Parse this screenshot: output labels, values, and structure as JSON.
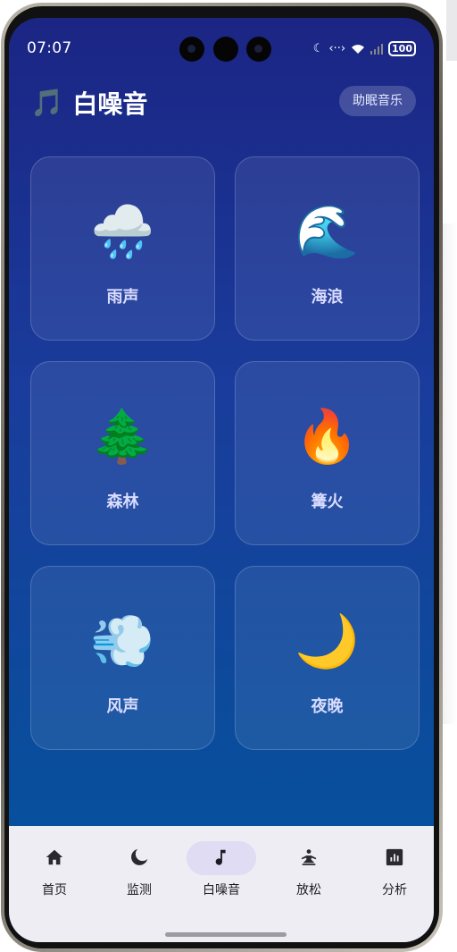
{
  "status_bar": {
    "time": "07:07",
    "battery": "100"
  },
  "header": {
    "icon": "🎵",
    "title": "白噪音",
    "action_label": "助眠音乐"
  },
  "sounds": [
    {
      "emoji": "🌧️",
      "label": "雨声",
      "icon_name": "rain-cloud-icon"
    },
    {
      "emoji": "🌊",
      "label": "海浪",
      "icon_name": "wave-icon"
    },
    {
      "emoji": "🌲",
      "label": "森林",
      "icon_name": "tree-icon"
    },
    {
      "emoji": "🔥",
      "label": "篝火",
      "icon_name": "fire-icon"
    },
    {
      "emoji": "💨",
      "label": "风声",
      "icon_name": "wind-icon"
    },
    {
      "emoji": "🌙",
      "label": "夜晚",
      "icon_name": "moon-icon"
    }
  ],
  "tabs": [
    {
      "label": "首页",
      "icon_name": "home-icon",
      "active": false
    },
    {
      "label": "监测",
      "icon_name": "moon-icon",
      "active": false
    },
    {
      "label": "白噪音",
      "icon_name": "music-note-icon",
      "active": true
    },
    {
      "label": "放松",
      "icon_name": "meditation-icon",
      "active": false
    },
    {
      "label": "分析",
      "icon_name": "bar-chart-icon",
      "active": false
    }
  ],
  "colors": {
    "gradient_top": "#1b2584",
    "gradient_bottom": "#02559d",
    "tab_active_bg": "#dfdcf3",
    "tabbar_bg": "#eeedf3"
  }
}
